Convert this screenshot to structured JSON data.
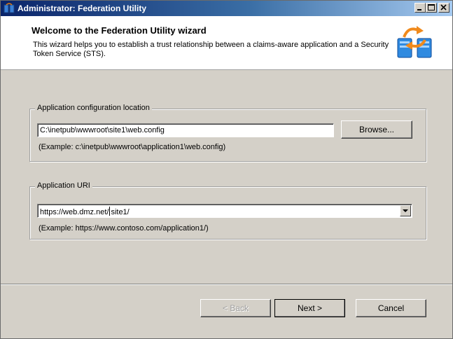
{
  "window": {
    "title": "Administrator: Federation Utility",
    "icon": "federation-app-icon",
    "controls": [
      "minimize-icon",
      "maximize-icon",
      "close-icon"
    ]
  },
  "header": {
    "title": "Welcome to the Federation Utility wizard",
    "description": "This wizard helps you to establish a trust relationship between a claims-aware application and a Security Token Service (STS).",
    "icon": "federation-servers-icon"
  },
  "config_group": {
    "legend": "Application configuration location",
    "path_value": "C:\\inetpub\\wwwroot\\site1\\web.config",
    "browse_label": "Browse...",
    "example": "(Example: c:\\inetpub\\wwwroot\\application1\\web.config)"
  },
  "uri_group": {
    "legend": "Application URI",
    "uri_value_before_caret": "https://web.dmz.net/",
    "uri_value_after_caret": "site1/",
    "example": "(Example: https://www.contoso.com/application1/)"
  },
  "footer": {
    "back_label": "< Back",
    "next_label": "Next >",
    "cancel_label": "Cancel"
  },
  "colors": {
    "title_bar_start": "#0a246a",
    "title_bar_end": "#a6caf0",
    "dialog_face": "#d4d0c8",
    "header_background": "#ffffff"
  }
}
